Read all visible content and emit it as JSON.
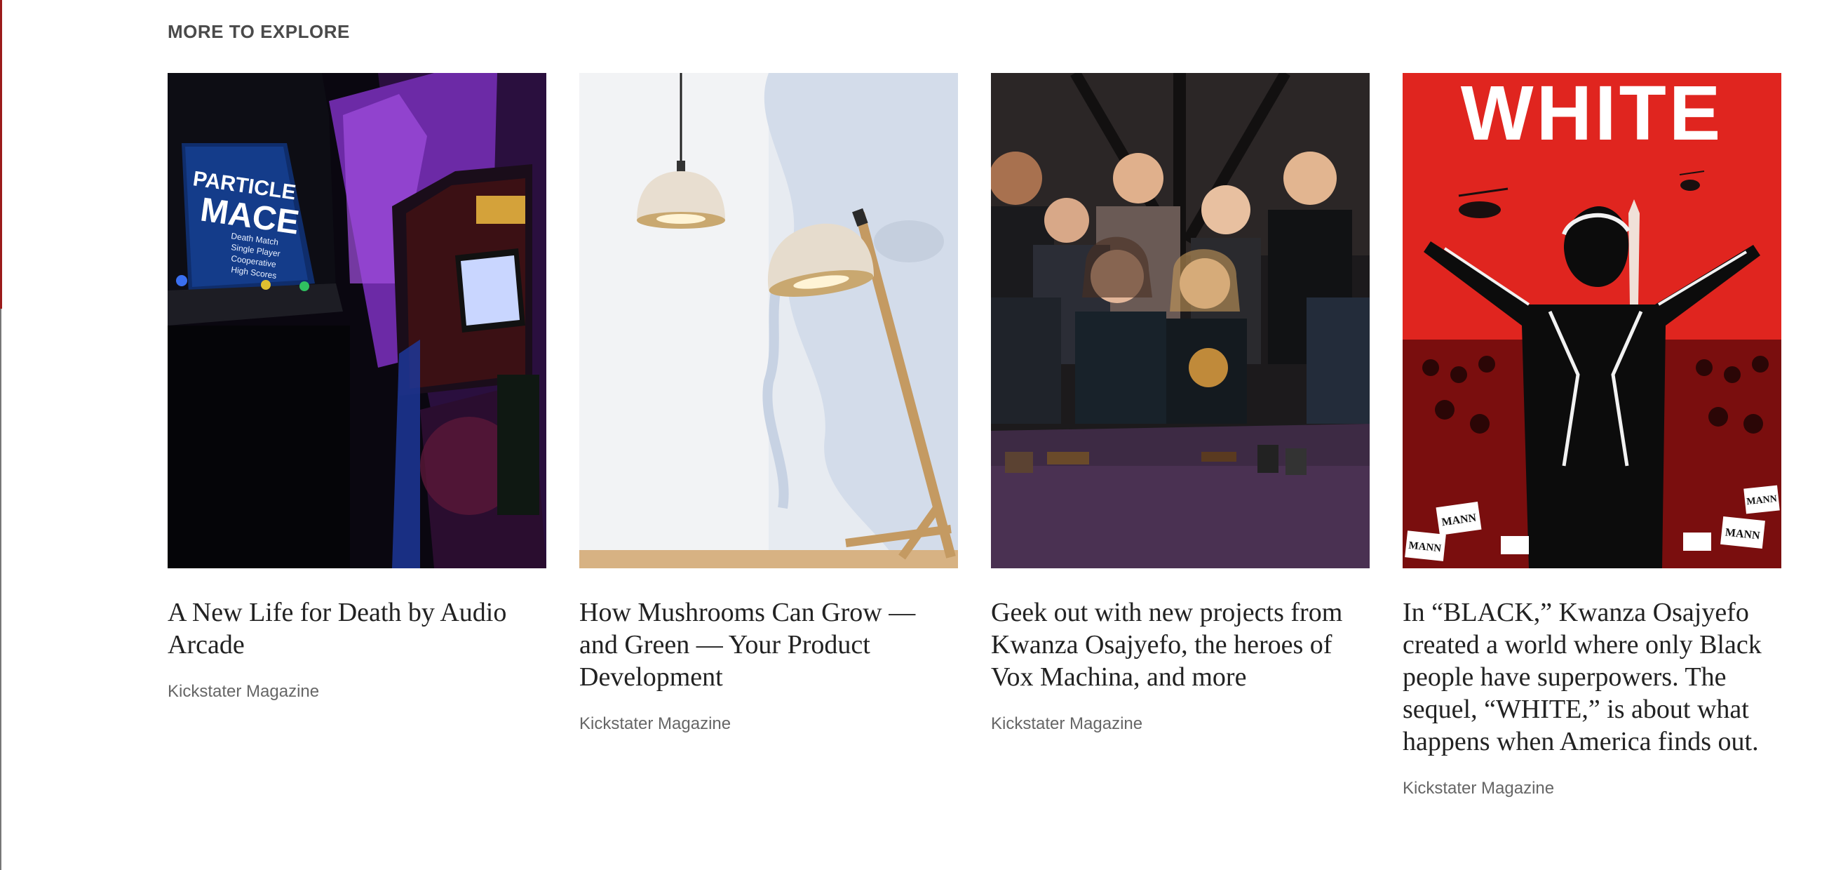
{
  "section": {
    "title": "MORE TO EXPLORE"
  },
  "cards": [
    {
      "title": "A New Life for Death by Audio Arcade",
      "source": "Kickstater Magazine",
      "image": "arcade-cabinets-photo",
      "image_text": {
        "screen_line1": "PARTICLE",
        "screen_line2": "MACE",
        "menu": [
          "Death Match",
          "Single Player",
          "Cooperative",
          "High Scores"
        ]
      }
    },
    {
      "title": "How Mushrooms Can Grow — and Green — Your Product Development",
      "source": "Kickstater Magazine",
      "image": "mushroom-lamps-photo"
    },
    {
      "title": "Geek out with new projects from Kwanza Osajyefo, the heroes of Vox Machina, and more",
      "source": "Kickstater Magazine",
      "image": "vox-machina-cast-photo"
    },
    {
      "title": "In “BLACK,” Kwanza Osajyefo created a world where only Black people have superpowers. The sequel, “WHITE,” is about what happens when America finds out.",
      "source": "Kickstater Magazine",
      "image": "white-comic-cover",
      "image_text": {
        "cover_title": "WHITE",
        "signs": [
          "MANN",
          "MANN",
          "MANN",
          "MANN"
        ]
      }
    }
  ],
  "colors": {
    "accent_red": "#e0251f",
    "text": "#222222",
    "muted": "#666666"
  }
}
